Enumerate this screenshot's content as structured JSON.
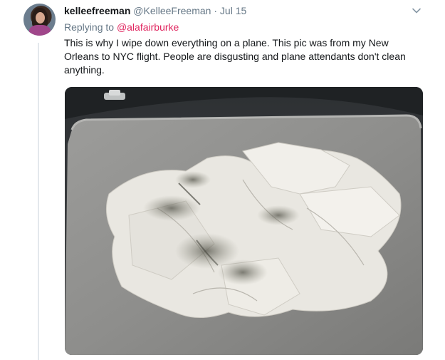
{
  "tweet": {
    "display_name": "kelleefreeman",
    "handle": "@KelleeFreeman",
    "separator": "·",
    "date": "Jul 15",
    "replying_prefix": "Replying to",
    "replying_to": "@alafairburke",
    "text": "This is why I wipe down everything on a plane. This pic was from my New Orleans to NYC flight. People are disgusting and plane attendants don't clean anything.",
    "menu_icon": "chevron-down-icon",
    "photo_icon": "tray-table-napkins-photo"
  },
  "colors": {
    "name": "#14171a",
    "secondary": "#657786",
    "mention": "#e0245e",
    "thread_line": "#e3e8ec"
  }
}
